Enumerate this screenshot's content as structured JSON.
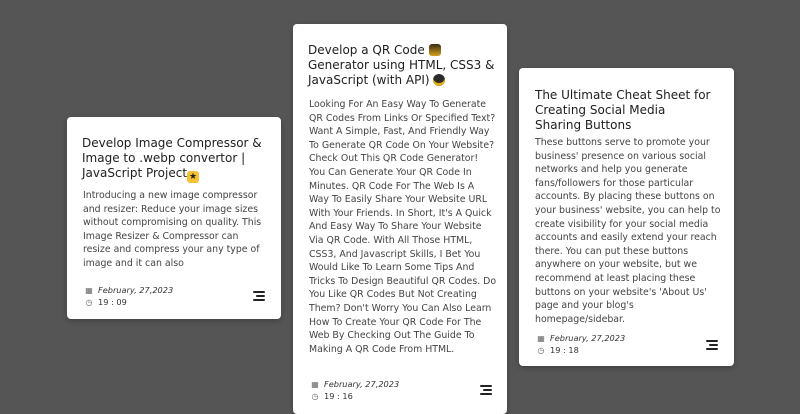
{
  "cards": [
    {
      "title": "Develop Image Compressor & Image to .webp convertor | JavaScript Project",
      "title_emoji": "🤩",
      "description": "Introducing a new image compressor and resizer: Reduce your image sizes without compromising on quality. This Image Resizer & Compressor can resize and compress your any type of image and it can also",
      "date": "February, 27,2023",
      "time": "19 : 09"
    },
    {
      "title": "Develop a QR Code",
      "title_emoji": "🎆",
      "title_rest": "Generator using HTML, CSS3 & JavaScript (with API)",
      "title_emoji2": "🐤",
      "description": "Looking For An Easy Way To Generate QR Codes From Links Or Specified Text? Want A Simple, Fast, And Friendly Way To Generate QR Code On Your Website? Check Out This QR Code Generator! You Can Generate Your QR Code In Minutes. QR Code For The Web Is A Way To Easily Share Your Website URL With Your Friends. In Short, It's A Quick And Easy Way To Share Your Website Via QR Code. With All Those HTML, CSS3, And Javascript Skills, I Bet You Would Like To Learn Some Tips And Tricks To Design Beautiful QR Codes. Do You Like QR Codes But Not Creating Them? Don't Worry You Can Also Learn How To Create Your QR Code For The Web By Checking Out The Guide To Making A QR Code From HTML.",
      "date": "February, 27,2023",
      "time": "19 : 16"
    },
    {
      "title": "The Ultimate Cheat Sheet for Creating Social Media Sharing Buttons",
      "description": "These buttons serve to promote your business' presence on various social networks and help you generate fans/followers for those particular accounts. By placing these buttons on your business' website, you can help to create visibility for your social media accounts and easily extend your reach there. You can put these buttons anywhere on your website, but we recommend at least placing these buttons on your website's 'About Us' page and your blog's homepage/sidebar.",
      "date": "February, 27,2023",
      "time": "19 : 18"
    }
  ]
}
